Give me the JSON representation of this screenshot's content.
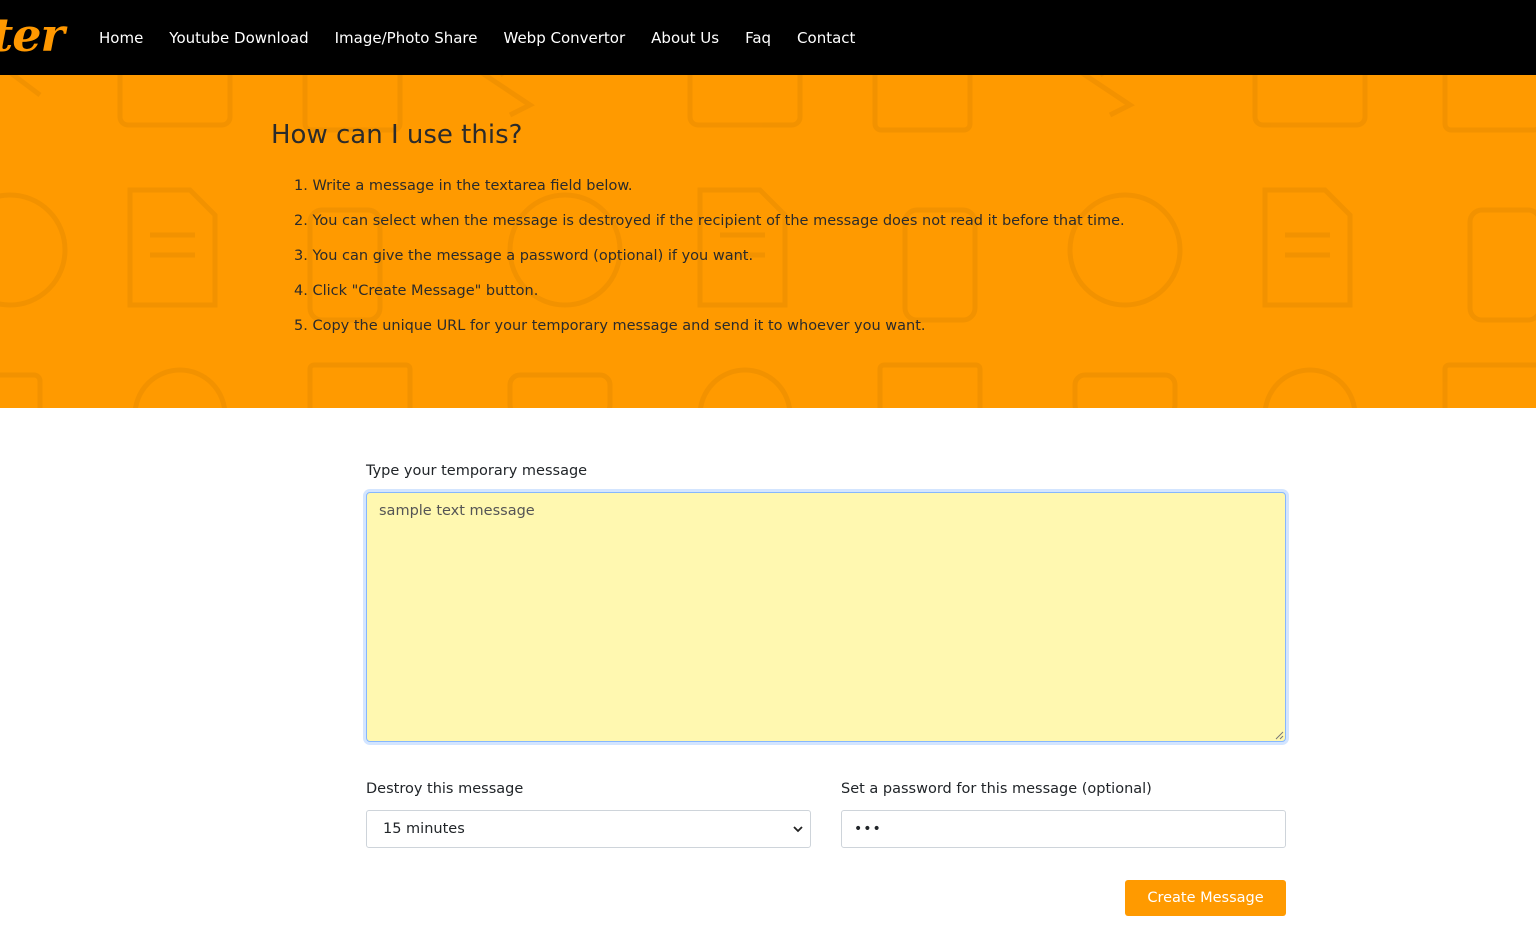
{
  "brand": {
    "logo_text": "ter",
    "accent": "#ff9a00"
  },
  "nav": {
    "items": [
      "Home",
      "Youtube Download",
      "Image/Photo Share",
      "Webp Convertor",
      "About Us",
      "Faq",
      "Contact"
    ]
  },
  "hero": {
    "title": "How can I use this?",
    "steps": [
      "1. Write a message in the textarea field below.",
      "2. You can select when the message is destroyed if the recipient of the message does not read it before that time.",
      "3. You can give the message a password (optional) if you want.",
      "4. Click \"Create Message\" button.",
      "5. Copy the unique URL for your temporary message and send it to whoever you want."
    ],
    "background_color": "#ff9a00"
  },
  "form": {
    "message_label": "Type your temporary message",
    "message_value": "sample text message",
    "message_bg": "#fff8b0",
    "destroy_label": "Destroy this message",
    "destroy_value": "15 minutes",
    "password_label": "Set a password for this message (optional)",
    "password_value": "•••",
    "submit_label": "Create Message"
  },
  "icons": [
    "chevron-down-icon",
    "resize-handle-icon"
  ]
}
